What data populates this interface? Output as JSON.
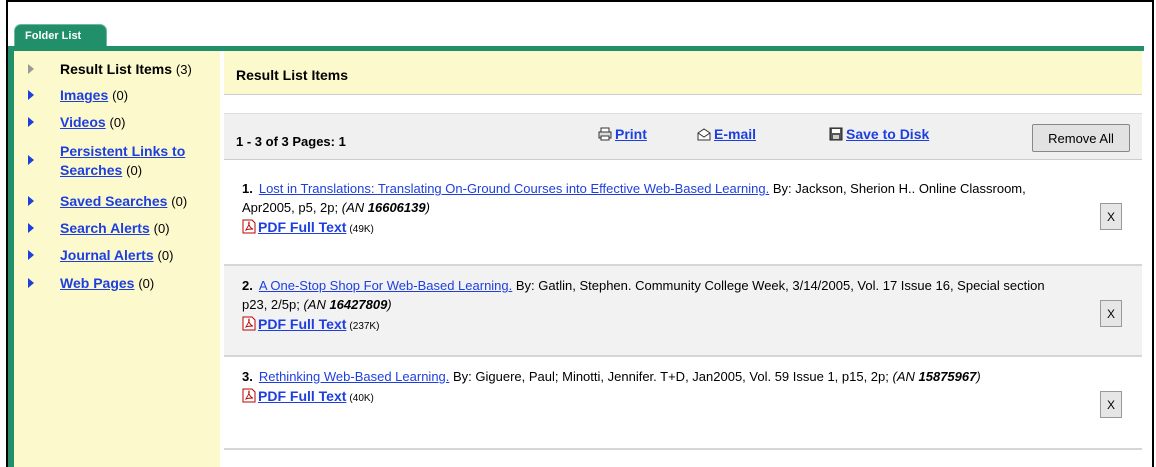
{
  "tab": {
    "label": "Folder List"
  },
  "sidebar": {
    "items": [
      {
        "label": "Result List Items",
        "count": "(3)",
        "link": false,
        "lines": 1
      },
      {
        "label": "Images",
        "count": "(0)",
        "link": true,
        "lines": 1
      },
      {
        "label": "Videos",
        "count": "(0)",
        "link": true,
        "lines": 1
      },
      {
        "label_line1": "Persistent Links to",
        "label": "Searches",
        "count": "(0)",
        "link": true,
        "lines": 2
      },
      {
        "label": "Saved Searches",
        "count": "(0)",
        "link": true,
        "lines": 1
      },
      {
        "label": "Search Alerts",
        "count": "(0)",
        "link": true,
        "lines": 1
      },
      {
        "label": "Journal Alerts",
        "count": "(0)",
        "link": true,
        "lines": 1
      },
      {
        "label": "Web Pages",
        "count": "(0)",
        "link": true,
        "lines": 1
      }
    ]
  },
  "main": {
    "header": "Result List Items",
    "toolbar": {
      "count_text": "1 - 3 of 3  Pages: 1",
      "print": "Print",
      "email": "E-mail",
      "save": "Save to Disk",
      "remove_all": "Remove All"
    },
    "results": [
      {
        "num": "1.",
        "title": "Lost in Translations: Translating On-Ground Courses into Effective Web-Based Learning.",
        "citation": " By: Jackson, Sherion H.. Online Classroom, Apr2005, p5, 2p; ",
        "an_label": "(AN ",
        "an": "16606139",
        "an_close": ")",
        "pdf": "PDF Full Text",
        "size": "(49K)",
        "remove": "X"
      },
      {
        "num": "2.",
        "title": "A One-Stop Shop For Web-Based Learning.",
        "citation": " By: Gatlin, Stephen. Community College Week, 3/14/2005, Vol. 17 Issue 16, Special section p23, 2/5p; ",
        "an_label": "(AN ",
        "an": "16427809",
        "an_close": ")",
        "pdf": "PDF Full Text",
        "size": "(237K)",
        "remove": "X"
      },
      {
        "num": "3.",
        "title": "Rethinking Web-Based Learning.",
        "citation": " By: Giguere, Paul; Minotti, Jennifer. T+D, Jan2005, Vol. 59 Issue 1, p15, 2p; ",
        "an_label": "(AN ",
        "an": "15875967",
        "an_close": ")",
        "pdf": "PDF Full Text",
        "size": "(40K)",
        "remove": "X"
      }
    ]
  },
  "colors": {
    "tab_green": "#208f6a",
    "link_blue": "#1e3fe0",
    "sidebar_yellow": "#fcf9cc"
  }
}
